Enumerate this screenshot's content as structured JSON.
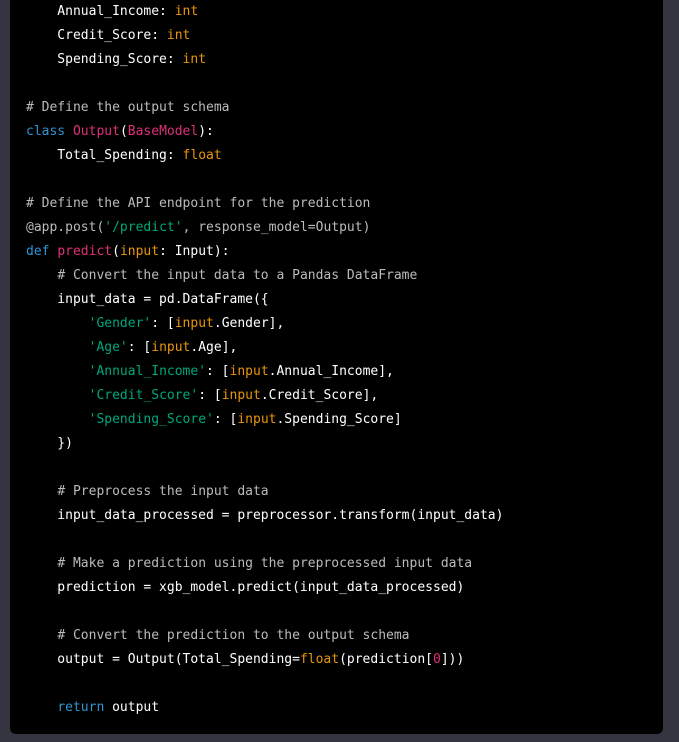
{
  "colors": {
    "page_background": "#343541",
    "code_background": "#000000",
    "text": "#ffffff",
    "keyword": "#2e95d3",
    "class_name": "#df3079",
    "builtin": "#e9950c",
    "string": "#00a67d",
    "comment": "#bbbbbb",
    "number": "#df3079"
  },
  "code_lines": [
    [
      {
        "t": "text",
        "v": "    Annual_Income: "
      },
      {
        "t": "builtin",
        "v": "int"
      }
    ],
    [
      {
        "t": "text",
        "v": "    Credit_Score: "
      },
      {
        "t": "builtin",
        "v": "int"
      }
    ],
    [
      {
        "t": "text",
        "v": "    Spending_Score: "
      },
      {
        "t": "builtin",
        "v": "int"
      }
    ],
    [],
    [
      {
        "t": "comment",
        "v": "# Define the output schema"
      }
    ],
    [
      {
        "t": "keyword",
        "v": "class"
      },
      {
        "t": "text",
        "v": " "
      },
      {
        "t": "type",
        "v": "Output"
      },
      {
        "t": "text",
        "v": "("
      },
      {
        "t": "type",
        "v": "BaseModel"
      },
      {
        "t": "text",
        "v": "):"
      }
    ],
    [
      {
        "t": "text",
        "v": "    Total_Spending: "
      },
      {
        "t": "builtin",
        "v": "float"
      }
    ],
    [],
    [
      {
        "t": "comment",
        "v": "# Define the API endpoint for the prediction"
      }
    ],
    [
      {
        "t": "comment",
        "v": "@app.post("
      },
      {
        "t": "string",
        "v": "'/predict'"
      },
      {
        "t": "comment",
        "v": ", response_model=Output)"
      }
    ],
    [
      {
        "t": "keyword",
        "v": "def"
      },
      {
        "t": "text",
        "v": " "
      },
      {
        "t": "type",
        "v": "predict"
      },
      {
        "t": "text",
        "v": "("
      },
      {
        "t": "builtin",
        "v": "input"
      },
      {
        "t": "text",
        "v": ": Input):"
      }
    ],
    [
      {
        "t": "text",
        "v": "    "
      },
      {
        "t": "comment",
        "v": "# Convert the input data to a Pandas DataFrame"
      }
    ],
    [
      {
        "t": "text",
        "v": "    input_data = pd.DataFrame({"
      }
    ],
    [
      {
        "t": "text",
        "v": "        "
      },
      {
        "t": "string",
        "v": "'Gender'"
      },
      {
        "t": "text",
        "v": ": ["
      },
      {
        "t": "builtin",
        "v": "input"
      },
      {
        "t": "text",
        "v": ".Gender],"
      }
    ],
    [
      {
        "t": "text",
        "v": "        "
      },
      {
        "t": "string",
        "v": "'Age'"
      },
      {
        "t": "text",
        "v": ": ["
      },
      {
        "t": "builtin",
        "v": "input"
      },
      {
        "t": "text",
        "v": ".Age],"
      }
    ],
    [
      {
        "t": "text",
        "v": "        "
      },
      {
        "t": "string",
        "v": "'Annual_Income'"
      },
      {
        "t": "text",
        "v": ": ["
      },
      {
        "t": "builtin",
        "v": "input"
      },
      {
        "t": "text",
        "v": ".Annual_Income],"
      }
    ],
    [
      {
        "t": "text",
        "v": "        "
      },
      {
        "t": "string",
        "v": "'Credit_Score'"
      },
      {
        "t": "text",
        "v": ": ["
      },
      {
        "t": "builtin",
        "v": "input"
      },
      {
        "t": "text",
        "v": ".Credit_Score],"
      }
    ],
    [
      {
        "t": "text",
        "v": "        "
      },
      {
        "t": "string",
        "v": "'Spending_Score'"
      },
      {
        "t": "text",
        "v": ": ["
      },
      {
        "t": "builtin",
        "v": "input"
      },
      {
        "t": "text",
        "v": ".Spending_Score]"
      }
    ],
    [
      {
        "t": "text",
        "v": "    })"
      }
    ],
    [],
    [
      {
        "t": "text",
        "v": "    "
      },
      {
        "t": "comment",
        "v": "# Preprocess the input data"
      }
    ],
    [
      {
        "t": "text",
        "v": "    input_data_processed = preprocessor.transform(input_data)"
      }
    ],
    [],
    [
      {
        "t": "text",
        "v": "    "
      },
      {
        "t": "comment",
        "v": "# Make a prediction using the preprocessed input data"
      }
    ],
    [
      {
        "t": "text",
        "v": "    prediction = xgb_model.predict(input_data_processed)"
      }
    ],
    [],
    [
      {
        "t": "text",
        "v": "    "
      },
      {
        "t": "comment",
        "v": "# Convert the prediction to the output schema"
      }
    ],
    [
      {
        "t": "text",
        "v": "    output = Output(Total_Spending="
      },
      {
        "t": "builtin",
        "v": "float"
      },
      {
        "t": "text",
        "v": "(prediction["
      },
      {
        "t": "number",
        "v": "0"
      },
      {
        "t": "text",
        "v": "]))"
      }
    ],
    [],
    [
      {
        "t": "text",
        "v": "    "
      },
      {
        "t": "keyword",
        "v": "return"
      },
      {
        "t": "text",
        "v": " output"
      }
    ]
  ]
}
